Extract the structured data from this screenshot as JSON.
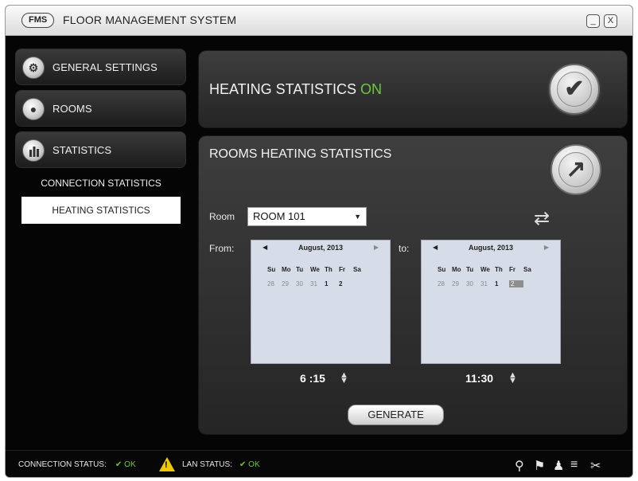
{
  "window": {
    "logo": "FMS",
    "title": "FLOOR MANAGEMENT SYSTEM",
    "minimize": "_",
    "close": "X"
  },
  "sidebar": {
    "items": [
      {
        "label": "GENERAL SETTINGS",
        "icon": "gear-icon"
      },
      {
        "label": "ROOMS",
        "icon": "person-icon"
      },
      {
        "label": "STATISTICS",
        "icon": "bar-chart-icon"
      }
    ],
    "submenu": [
      {
        "label": "CONNECTION STATISTICS",
        "active": false
      },
      {
        "label": "HEATING STATISTICS",
        "active": true
      }
    ]
  },
  "heating_panel": {
    "title": "HEATING STATISTICS",
    "status": "ON",
    "status_color": "#6cc93a",
    "icon": "checkmark-icon"
  },
  "stats_panel": {
    "title": "ROOMS HEATING STATISTICS",
    "icon": "trend-up-icon",
    "room_label": "Room",
    "room_value": "ROOM 101",
    "from_label": "From:",
    "to_label": "to:",
    "from_calendar": {
      "month": "August, 2013",
      "days": [
        "Su",
        "Mo",
        "Tu",
        "We",
        "Th",
        "Fr",
        "Sa"
      ],
      "dates": [
        "28",
        "29",
        "30",
        "31",
        "1",
        "2"
      ],
      "selected": null
    },
    "to_calendar": {
      "month": "August, 2013",
      "days": [
        "Su",
        "Mo",
        "Tu",
        "We",
        "Th",
        "Fr",
        "Sa"
      ],
      "dates": [
        "28",
        "29",
        "30",
        "31",
        "1",
        "2"
      ],
      "selected": "2"
    },
    "from_time": "6 :15",
    "to_time": "11:30",
    "generate_label": "GENERATE"
  },
  "statusbar": {
    "connection_label": "CONNECTION STATUS:",
    "connection_value": "OK",
    "lan_label": "LAN STATUS:",
    "lan_value": "OK",
    "icons": [
      "wrench-icon",
      "flag-icon",
      "user-icon",
      "list-icon",
      "tools-icon"
    ]
  }
}
